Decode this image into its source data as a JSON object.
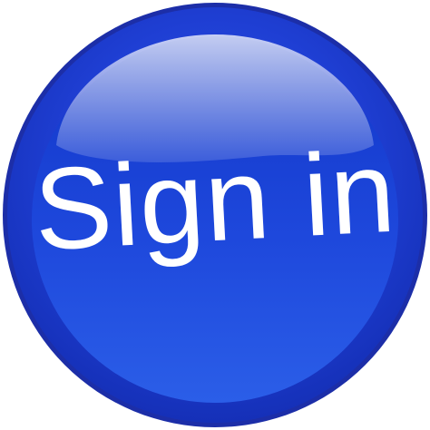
{
  "button": {
    "label": "Sign in",
    "colors": {
      "rim": "#1c2ea8",
      "outer": "#2b44d6",
      "inner_top": "#1436c8",
      "inner_bottom": "#2a5ae6",
      "highlight": "#c9d4ff",
      "text": "#ffffff"
    }
  }
}
